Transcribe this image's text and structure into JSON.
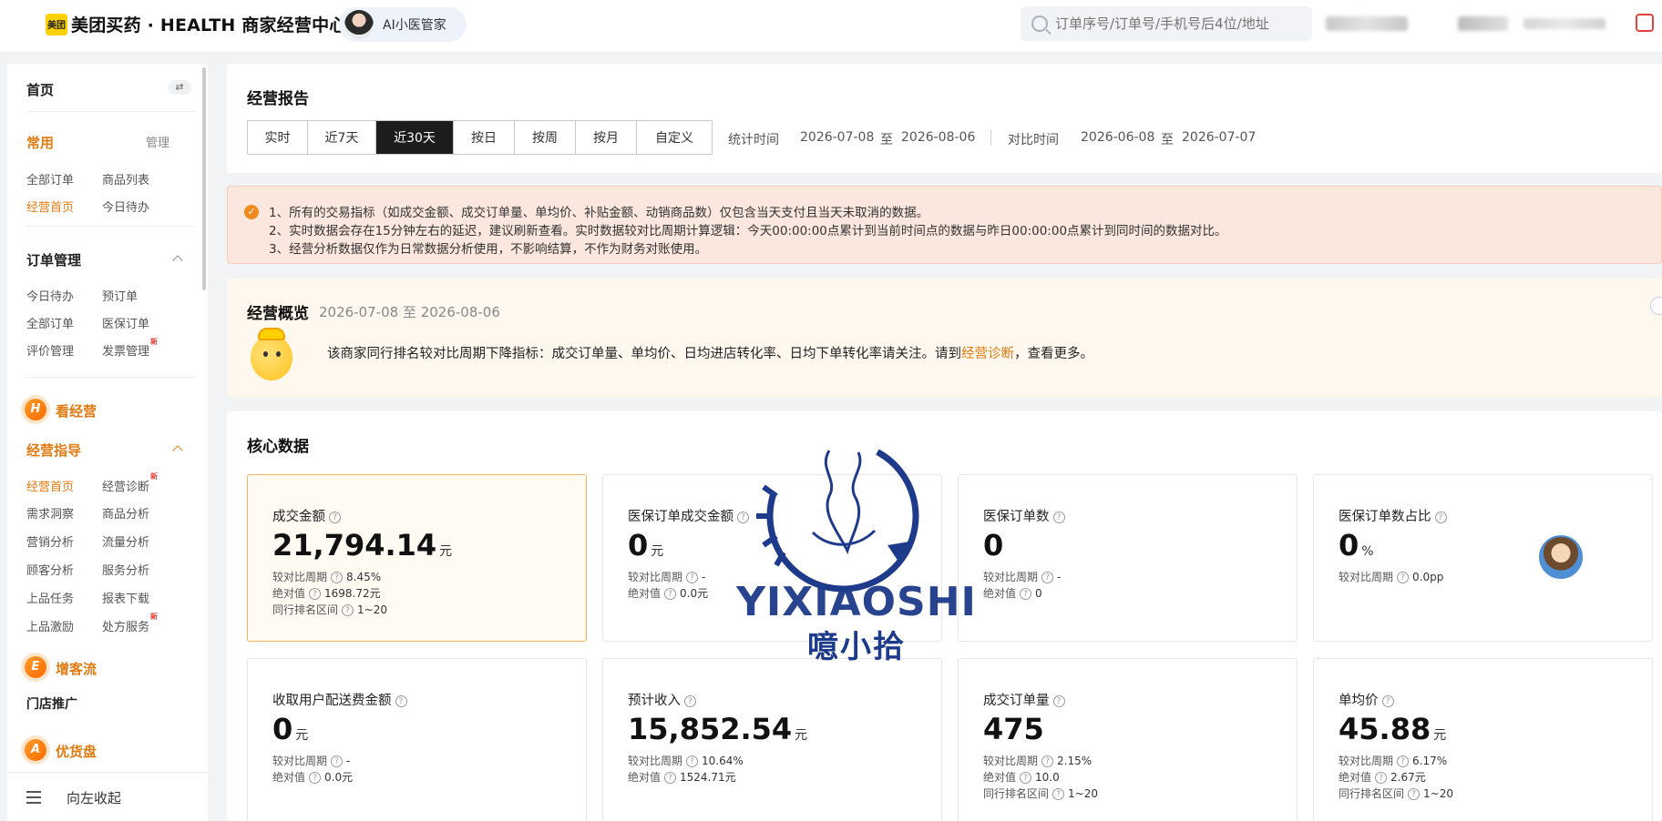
{
  "header": {
    "logo_text": "美团",
    "title": "美团买药 · HEALTH 商家经营中心",
    "ai_assistant": "AI小医管家",
    "search_placeholder": "订单序号/订单号/手机号后4位/地址"
  },
  "sidebar": {
    "home": "首页",
    "switch_icon": "⇄",
    "common_title": "常用",
    "manage": "管理",
    "common_items": [
      "全部订单",
      "商品列表",
      "经营首页",
      "今日待办"
    ],
    "order_title": "订单管理",
    "order_items": [
      "今日待办",
      "预订单",
      "全部订单",
      "医保订单",
      "评价管理",
      "发票管理"
    ],
    "new_badge": "新",
    "kan_jingying": {
      "badge": "H",
      "label": "看经营"
    },
    "guide_title": "经营指导",
    "guide_items": [
      "经营首页",
      "经营诊断",
      "需求洞察",
      "商品分析",
      "营销分析",
      "流量分析",
      "顾客分析",
      "服务分析",
      "上品任务",
      "报表下载",
      "上品激励",
      "处方服务"
    ],
    "zeng_keliu": {
      "badge": "E",
      "label": "增客流"
    },
    "store_promo": "门店推广",
    "you_huopan": {
      "badge": "A",
      "label": "优货盘"
    },
    "collapse": "向左收起"
  },
  "report": {
    "title": "经营报告",
    "tabs": [
      "实时",
      "近7天",
      "近30天",
      "按日",
      "按周",
      "按月",
      "自定义"
    ],
    "active_tab": "近30天",
    "stat_label": "统计时间",
    "stat_start": "2026-07-08",
    "to": "至",
    "stat_end": "2026-08-06",
    "compare_label": "对比时间",
    "compare_start": "2026-06-08",
    "compare_end": "2026-07-07"
  },
  "notice": {
    "lines": [
      "1、所有的交易指标（如成交金额、成交订单量、单均价、补贴金额、动销商品数）仅包含当天支付且当天未取消的数据。",
      "2、实时数据会存在15分钟左右的延迟，建议刷新查看。实时数据较对比周期计算逻辑：今天00:00:00点累计到当前时间点的数据与昨日00:00:00点累计到同时间的数据对比。",
      "3、经营分析数据仅作为日常数据分析使用，不影响结算，不作为财务对账使用。"
    ]
  },
  "overview": {
    "title": "经营概览",
    "date_range": "2026-07-08 至 2026-08-06",
    "text_before": "该商家同行排名较对比周期下降指标：成交订单量、单均价、日均进店转化率、日均下单转化率请关注。请到",
    "link": "经营诊断",
    "text_after": "，查看更多。"
  },
  "core": {
    "title": "核心数据",
    "q": "?",
    "labels": {
      "compare": "较对比周期",
      "absolute": "绝对值",
      "rank": "同行排名区间"
    },
    "cards": [
      {
        "label": "成交金额",
        "value": "21,794.14",
        "unit": "元",
        "compare": "8.45%",
        "absolute": "1698.72元",
        "rank": "1~20"
      },
      {
        "label": "医保订单成交金额",
        "value": "0",
        "unit": "元",
        "compare": "-",
        "absolute": "0.0元"
      },
      {
        "label": "医保订单数",
        "value": "0",
        "unit": "",
        "compare": "-",
        "absolute": "0"
      },
      {
        "label": "医保订单数占比",
        "value": "0",
        "unit": "%",
        "compare": "0.0pp"
      },
      {
        "label": "收取用户配送费金额",
        "value": "0",
        "unit": "元",
        "compare": "-",
        "absolute": "0.0元"
      },
      {
        "label": "预计收入",
        "value": "15,852.54",
        "unit": "元",
        "compare": "10.64%",
        "absolute": "1524.71元"
      },
      {
        "label": "成交订单量",
        "value": "475",
        "unit": "",
        "compare": "2.15%",
        "absolute": "10.0",
        "rank": "1~20"
      },
      {
        "label": "单均价",
        "value": "45.88",
        "unit": "元",
        "compare": "6.17%",
        "absolute": "2.67元",
        "rank": "1~20"
      }
    ]
  },
  "watermark": {
    "latin": "YIXIAOSHI",
    "cn": "噫小拾"
  }
}
